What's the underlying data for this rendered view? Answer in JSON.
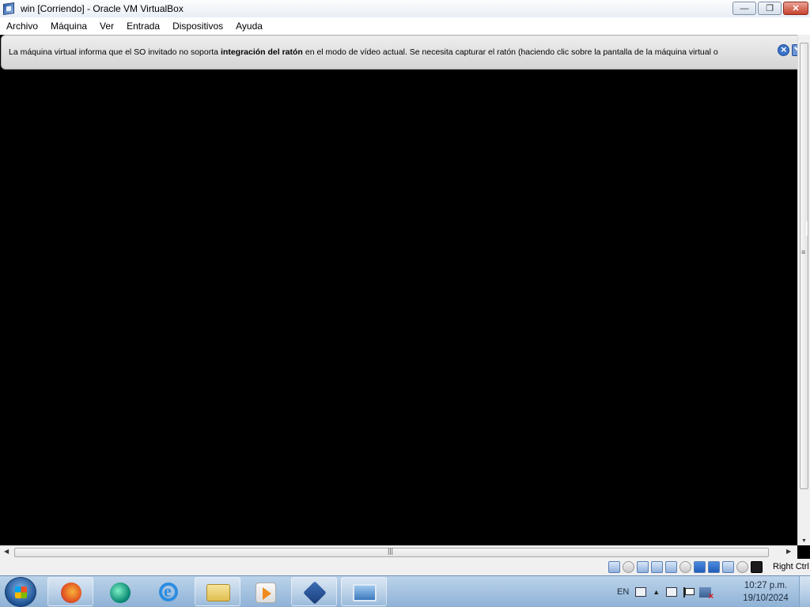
{
  "window": {
    "title": "win [Corriendo] - Oracle VM VirtualBox",
    "app_icon": "virtualbox-icon",
    "controls": {
      "minimize": "minimize-icon",
      "restore": "restore-icon",
      "close": "close-icon"
    }
  },
  "menu": {
    "items": [
      "Archivo",
      "Máquina",
      "Ver",
      "Entrada",
      "Dispositivos",
      "Ayuda"
    ]
  },
  "notice": {
    "text_before": "La máquina virtual informa que el SO invitado no soporta",
    "text_bold": "integración del ratón",
    "text_after": "en el modo de vídeo actual. Se necesita capturar el ratón (haciendo clic sobre la pantalla de la máquina virtual o",
    "icons": [
      "close-message-icon",
      "do-not-show-again-icon"
    ]
  },
  "statusbar": {
    "indicators": [
      "hard-disk-icon",
      "optical-drive-icon",
      "audio-icon",
      "network-icon",
      "usb-icon",
      "shared-folders-icon",
      "display-icon",
      "video-capture-icon",
      "virtualization-icon",
      "mouse-integration-icon",
      "keyboard-capture-icon"
    ],
    "host_key": "Right Ctrl"
  },
  "taskbar": {
    "pinned": [
      "firefox-icon",
      "app-icon",
      "internet-explorer-icon",
      "file-explorer-icon",
      "media-player-icon",
      "virtualbox-taskbar-icon",
      "image-viewer-icon"
    ],
    "tray": {
      "language": "EN",
      "time": "10:27 p.m.",
      "date": "19/10/2024"
    }
  },
  "colors": {
    "titlebar": "#e9eef6",
    "taskbar": "#9fbfdf",
    "vm_screen": "#000000"
  }
}
